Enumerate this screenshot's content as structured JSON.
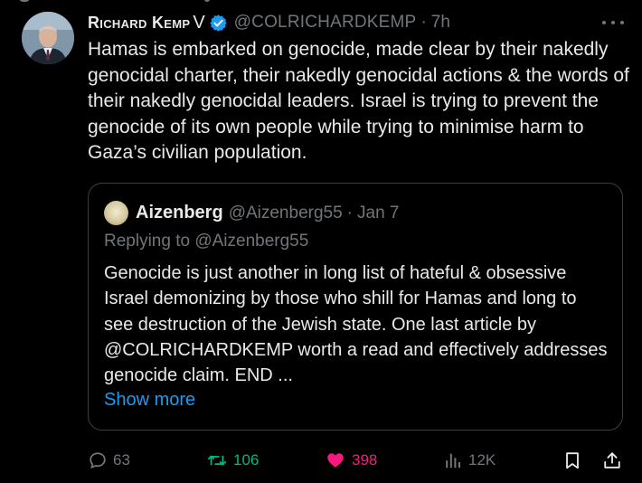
{
  "tweet": {
    "author": {
      "display_name": "Richard Kemp",
      "name_suffix": "V",
      "handle": "@COLRICHARDKEMP",
      "verified": true
    },
    "separator": "·",
    "time": "7h",
    "text": "Hamas is embarked on  genocide, made clear by their nakedly genocidal charter, their nakedly genocidal actions & the words of their nakedly genocidal leaders. Israel is trying to prevent the genocide of its own people while trying to minimise harm to Gaza’s civilian population."
  },
  "quoted_tweet": {
    "author": {
      "display_name": "Aizenberg",
      "handle": "@Aizenberg55"
    },
    "separator": "·",
    "date": "Jan 7",
    "replying_prefix": "Replying to",
    "replying_to": "@Aizenberg55",
    "text": "Genocide is just another in long list of hateful & obsessive Israel demonizing by those who shill for Hamas and long to see destruction of the Jewish state. One last article by @COLRICHARDKEMP worth a read and effectively addresses genocide claim. END ...",
    "show_more": "Show more"
  },
  "actions": {
    "replies": "63",
    "reposts": "106",
    "likes": "398",
    "views": "12K"
  },
  "colors": {
    "background": "#000000",
    "text": "#e7e9ea",
    "muted": "#71767b",
    "link": "#1d9bf0",
    "repost": "#00ba7c",
    "like": "#f91880",
    "verified": "#1d9bf0",
    "border": "#3a3e42"
  },
  "icons": {
    "more": "more-dots-icon",
    "reply": "reply-bubble-icon",
    "repost": "repost-arrows-icon",
    "like": "heart-filled-icon",
    "views": "views-bars-icon",
    "bookmark": "bookmark-icon",
    "share": "share-upload-icon",
    "verified": "verified-badge-icon"
  }
}
